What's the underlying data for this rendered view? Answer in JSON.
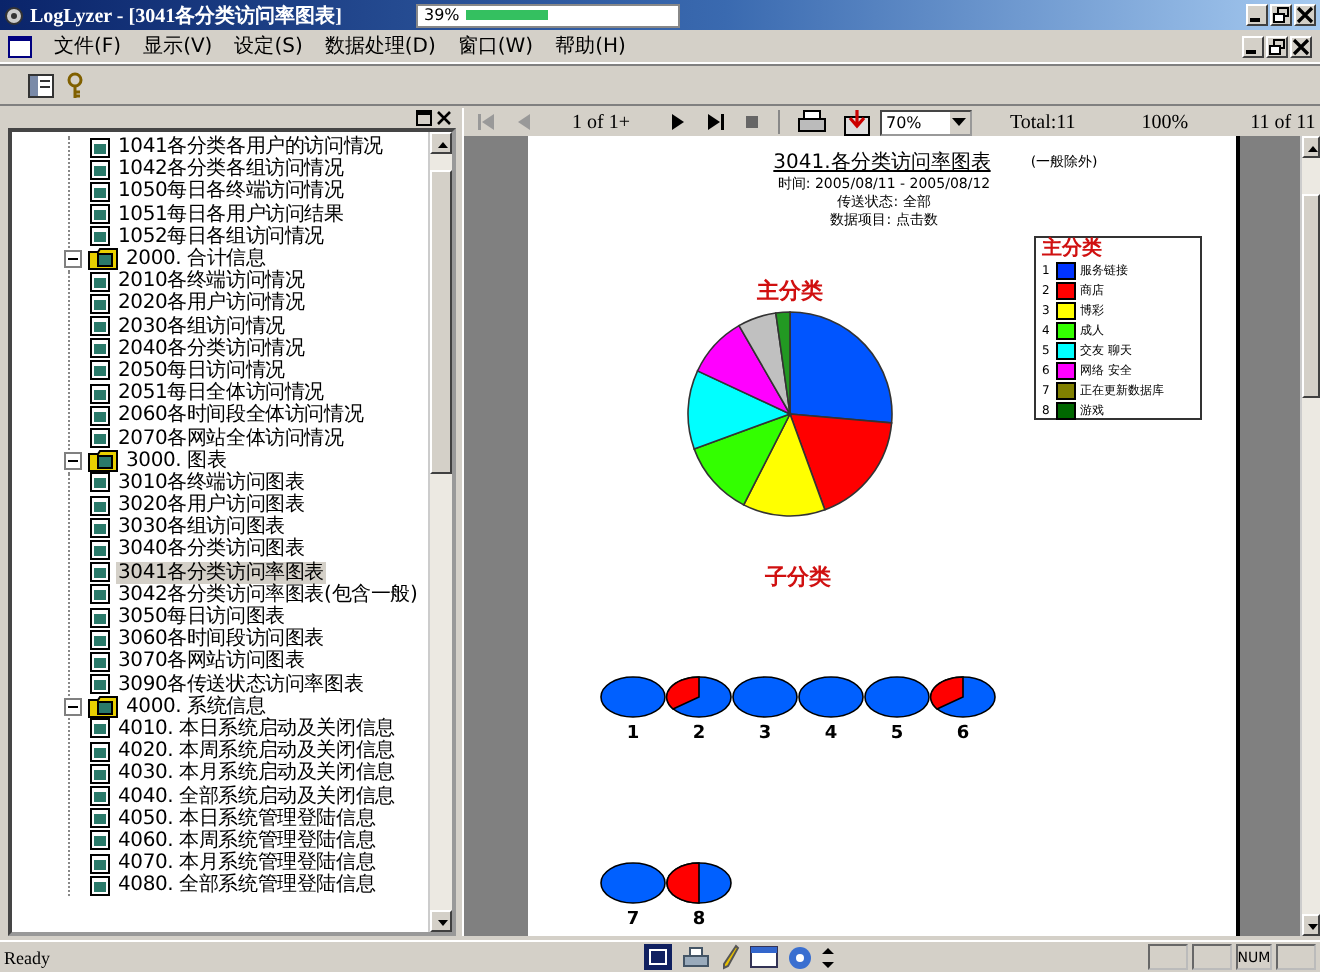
{
  "window": {
    "title": "LogLyzer - [3041各分类访问率图表]",
    "progress": {
      "label": "39%",
      "level": 0.39
    }
  },
  "menu": [
    "文件(F)",
    "显示(V)",
    "设定(S)",
    "数据处理(D)",
    "窗口(W)",
    "帮助(H)"
  ],
  "tree": {
    "continued_items": [
      {
        "label": "1041各分类各用户的访问情况",
        "selected": false
      },
      {
        "label": "1042各分类各组访问情况",
        "selected": false
      },
      {
        "label": "1050每日各终端访问情况",
        "selected": false
      },
      {
        "label": "1051每日各用户访问结果",
        "selected": false
      },
      {
        "label": "1052每日各组访问情况",
        "selected": false
      }
    ],
    "groups": [
      {
        "label": "2000. 合计信息",
        "expanded": true,
        "selected": false,
        "children": [
          {
            "label": "2010各终端访问情况",
            "selected": false
          },
          {
            "label": "2020各用户访问情况",
            "selected": false
          },
          {
            "label": "2030各组访问情况",
            "selected": false
          },
          {
            "label": "2040各分类访问情况",
            "selected": false
          },
          {
            "label": "2050每日访问情况",
            "selected": false
          },
          {
            "label": "2051每日全体访问情况",
            "selected": false
          },
          {
            "label": "2060各时间段全体访问情况",
            "selected": false
          },
          {
            "label": "2070各网站全体访问情况",
            "selected": false
          }
        ]
      },
      {
        "label": "3000. 图表",
        "expanded": true,
        "selected": false,
        "children": [
          {
            "label": "3010各终端访问图表",
            "selected": false
          },
          {
            "label": "3020各用户访问图表",
            "selected": false
          },
          {
            "label": "3030各组访问图表",
            "selected": false
          },
          {
            "label": "3040各分类访问图表",
            "selected": false
          },
          {
            "label": "3041各分类访问率图表",
            "selected": true
          },
          {
            "label": "3042各分类访问率图表(包含一般)",
            "selected": false
          },
          {
            "label": "3050每日访问图表",
            "selected": false
          },
          {
            "label": "3060各时间段访问图表",
            "selected": false
          },
          {
            "label": "3070各网站访问图表",
            "selected": false
          },
          {
            "label": "3090各传送状态访问率图表",
            "selected": false
          }
        ]
      },
      {
        "label": "4000. 系统信息",
        "expanded": true,
        "selected": false,
        "children": [
          {
            "label": "4010. 本日系统启动及关闭信息",
            "selected": false
          },
          {
            "label": "4020. 本周系统启动及关闭信息",
            "selected": false
          },
          {
            "label": "4030. 本月系统启动及关闭信息",
            "selected": false
          },
          {
            "label": "4040. 全部系统启动及关闭信息",
            "selected": false
          },
          {
            "label": "4050. 本日系统管理登陆信息",
            "selected": false
          },
          {
            "label": "4060. 本周系统管理登陆信息",
            "selected": false
          },
          {
            "label": "4070. 本月系统管理登陆信息",
            "selected": false
          },
          {
            "label": "4080. 全部系统管理登陆信息",
            "selected": false
          }
        ]
      }
    ]
  },
  "report_toolbar": {
    "page": "1 of 1+",
    "zoom": "70%",
    "total": "Total:11",
    "percent": "100%",
    "records": "11 of 11"
  },
  "report": {
    "title": "3041.各分类访问率图表",
    "note": "(一般除外)",
    "info": [
      "时间: 2005/08/11 - 2005/08/12",
      "传送状态: 全部",
      "数据项目: 点击数"
    ],
    "main_chart_title": "主分类",
    "legend": {
      "title": "主分类",
      "items": [
        {
          "number": "1",
          "label": "服务链接",
          "color": "#0033ff"
        },
        {
          "number": "2",
          "label": "商店",
          "color": "#ff0000"
        },
        {
          "number": "3",
          "label": "博彩",
          "color": "#ffff00"
        },
        {
          "number": "4",
          "label": "成人",
          "color": "#33ff00"
        },
        {
          "number": "5",
          "label": "交友 聊天",
          "color": "#00ffff"
        },
        {
          "number": "6",
          "label": "网络 安全",
          "color": "#ff00ff"
        },
        {
          "number": "7",
          "label": "正在更新数据库",
          "color": "#808000"
        },
        {
          "number": "8",
          "label": "游戏",
          "color": "#006600"
        }
      ]
    },
    "sub_chart_title": "子分类",
    "sub_charts": [
      {
        "label": "1",
        "kind": "full"
      },
      {
        "label": "2",
        "kind": "part"
      },
      {
        "label": "3",
        "kind": "full"
      },
      {
        "label": "4",
        "kind": "full"
      },
      {
        "label": "5",
        "kind": "full"
      },
      {
        "label": "6",
        "kind": "part"
      },
      {
        "label": "7",
        "kind": "full"
      },
      {
        "label": "8",
        "kind": "half"
      }
    ]
  },
  "status_bar": {
    "text": "Ready",
    "indicator": "NUM"
  }
}
